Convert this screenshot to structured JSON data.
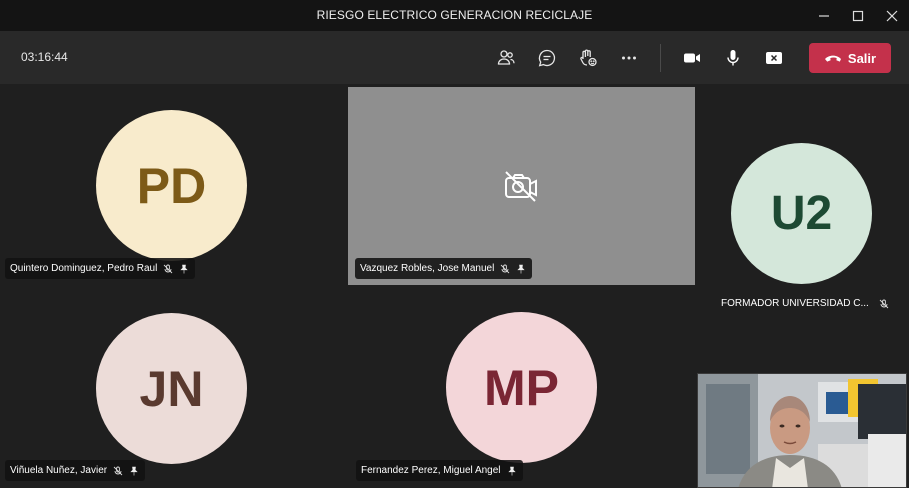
{
  "window": {
    "title": "RIESGO ELECTRICO GENERACION RECICLAJE",
    "controls": [
      "minimize-icon",
      "maximize-icon",
      "close-icon"
    ]
  },
  "toolbar": {
    "timer": "03:16:44",
    "buttons": [
      "participants-icon",
      "chat-icon",
      "reactions-icon",
      "more-options-icon",
      "camera-icon",
      "microphone-icon",
      "share-tray-icon"
    ],
    "leave_label": "Salir",
    "leave_color": "#c4314b"
  },
  "participants": [
    {
      "initials": "PD",
      "name": "Quintero Dominguez, Pedro Raul",
      "muted": true,
      "pinned": true,
      "avatar_bg": "#f8ebcc",
      "avatar_fg": "#7d5a17"
    },
    {
      "initials": "",
      "name": "Vazquez Robles, Jose Manuel",
      "muted": true,
      "pinned": true,
      "video_off": true
    },
    {
      "initials": "U2",
      "name": "FORMADOR UNIVERSIDAD C...",
      "muted": true,
      "pinned": false,
      "avatar_bg": "#d4e7da",
      "avatar_fg": "#1d4a33"
    },
    {
      "initials": "JN",
      "name": "Viñuela Nuñez, Javier",
      "muted": true,
      "pinned": true,
      "avatar_bg": "#ecdcd8",
      "avatar_fg": "#5a3a2f"
    },
    {
      "initials": "MP",
      "name": "Fernandez Perez, Miguel Angel",
      "muted": false,
      "pinned": true,
      "avatar_bg": "#f3d6d9",
      "avatar_fg": "#7a2634"
    }
  ],
  "self_view": {
    "label": "self-camera-view"
  }
}
